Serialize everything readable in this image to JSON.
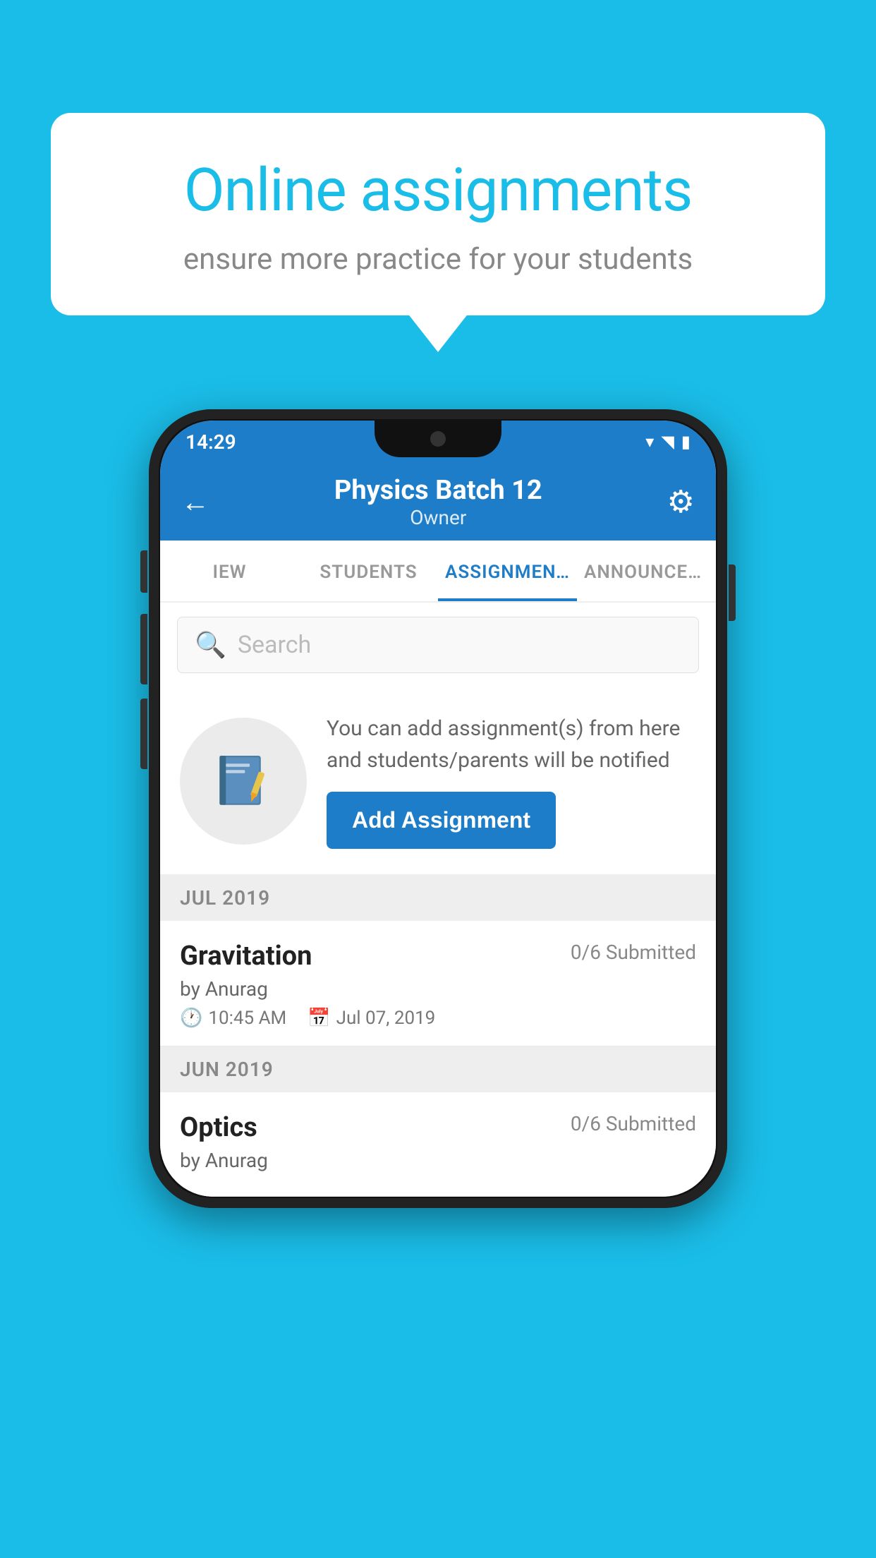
{
  "background_color": "#1ABDE8",
  "speech_bubble": {
    "title": "Online assignments",
    "subtitle": "ensure more practice for your students"
  },
  "status_bar": {
    "time": "14:29",
    "wifi_icon": "▾",
    "signal_icon": "◥",
    "battery_icon": "▮"
  },
  "app_header": {
    "back_label": "←",
    "title": "Physics Batch 12",
    "subtitle": "Owner",
    "settings_label": "⚙"
  },
  "tabs": [
    {
      "label": "IEW",
      "active": false
    },
    {
      "label": "STUDENTS",
      "active": false
    },
    {
      "label": "ASSIGNMENTS",
      "active": true
    },
    {
      "label": "ANNOUNCEMENTS",
      "active": false
    }
  ],
  "search": {
    "placeholder": "Search"
  },
  "add_assignment_section": {
    "description": "You can add assignment(s) from here and students/parents will be notified",
    "button_label": "Add Assignment"
  },
  "sections": [
    {
      "header": "JUL 2019",
      "assignments": [
        {
          "name": "Gravitation",
          "submitted": "0/6 Submitted",
          "by": "by Anurag",
          "time": "10:45 AM",
          "date": "Jul 07, 2019"
        }
      ]
    },
    {
      "header": "JUN 2019",
      "assignments": [
        {
          "name": "Optics",
          "submitted": "0/6 Submitted",
          "by": "by Anurag",
          "time": "",
          "date": ""
        }
      ]
    }
  ]
}
